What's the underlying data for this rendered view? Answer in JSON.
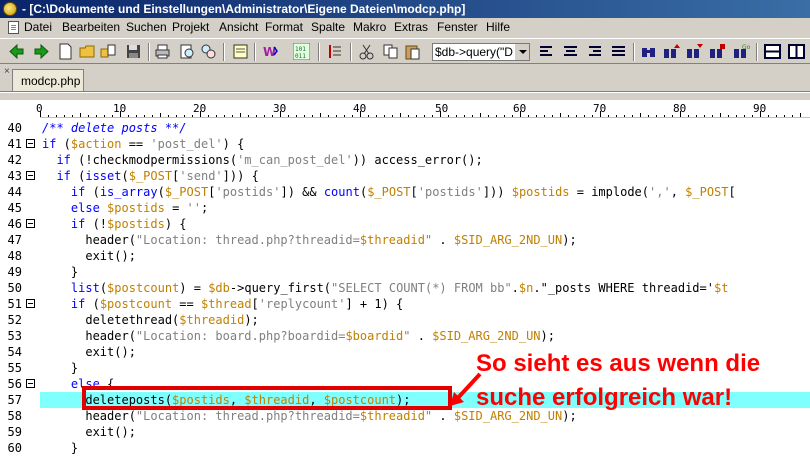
{
  "window": {
    "title": "- [C:\\Dokumente und Einstellungen\\Administrator\\Eigene Dateien\\modcp.php]"
  },
  "menu": [
    "Datei",
    "Bearbeiten",
    "Suchen",
    "Projekt",
    "Ansicht",
    "Format",
    "Spalte",
    "Makro",
    "Extras",
    "Fenster",
    "Hilfe"
  ],
  "toolbar": {
    "search_combo_value": "$db->query(\"DE"
  },
  "tabs": [
    {
      "label": "modcp.php"
    }
  ],
  "ruler": [
    "0",
    "10",
    "20",
    "30",
    "40",
    "50",
    "60",
    "70",
    "80",
    "90"
  ],
  "editor": {
    "lines": [
      {
        "num": "40",
        "fold": false,
        "code": "/** delete posts **/"
      },
      {
        "num": "41",
        "fold": true,
        "code": "if ($action == 'post_del') {"
      },
      {
        "num": "42",
        "fold": false,
        "code": "  if (!checkmodpermissions('m_can_post_del')) access_error();"
      },
      {
        "num": "43",
        "fold": true,
        "code": "  if (isset($_POST['send'])) {"
      },
      {
        "num": "44",
        "fold": false,
        "code": "    if (is_array($_POST['postids']) && count($_POST['postids'])) $postids = implode(',', $_POST["
      },
      {
        "num": "45",
        "fold": false,
        "code": "    else $postids = '';"
      },
      {
        "num": "46",
        "fold": true,
        "code": "    if (!$postids) {"
      },
      {
        "num": "47",
        "fold": false,
        "code": "      header(\"Location: thread.php?threadid=$threadid\" . $SID_ARG_2ND_UN);"
      },
      {
        "num": "48",
        "fold": false,
        "code": "      exit();"
      },
      {
        "num": "49",
        "fold": false,
        "code": "    }"
      },
      {
        "num": "50",
        "fold": false,
        "code": "    list($postcount) = $db->query_first(\"SELECT COUNT(*) FROM bb\".$n.\"_posts WHERE threadid='$t"
      },
      {
        "num": "51",
        "fold": true,
        "code": "    if ($postcount == $thread['replycount'] + 1) {"
      },
      {
        "num": "52",
        "fold": false,
        "code": "      deletethread($threadid);"
      },
      {
        "num": "53",
        "fold": false,
        "code": "      header(\"Location: board.php?boardid=$boardid\" . $SID_ARG_2ND_UN);"
      },
      {
        "num": "54",
        "fold": false,
        "code": "      exit();"
      },
      {
        "num": "55",
        "fold": false,
        "code": "    }"
      },
      {
        "num": "56",
        "fold": true,
        "code": "    else {"
      },
      {
        "num": "57",
        "fold": false,
        "code": "      deleteposts($postids, $threadid, $postcount);"
      },
      {
        "num": "58",
        "fold": false,
        "code": "      header(\"Location: thread.php?threadid=$threadid\" . $SID_ARG_2ND_UN);"
      },
      {
        "num": "59",
        "fold": false,
        "code": "      exit();"
      },
      {
        "num": "60",
        "fold": false,
        "code": "    }"
      }
    ],
    "highlighted_line": "57"
  },
  "annotation": {
    "line1": "So sieht es aus wenn die",
    "line2": "suche erfolgreich war!",
    "color": "#ff0000"
  }
}
